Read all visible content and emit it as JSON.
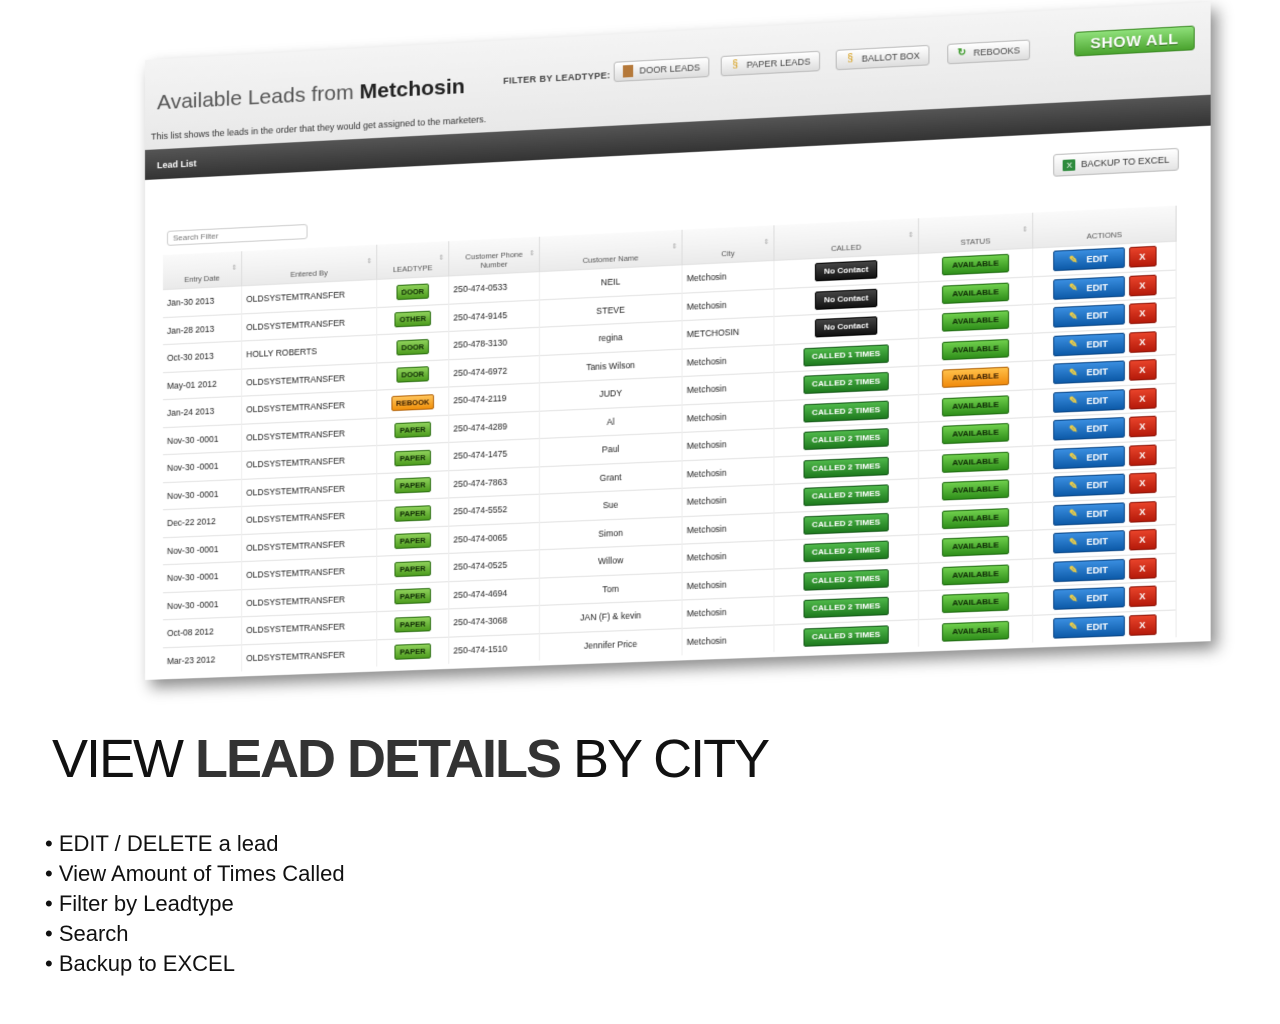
{
  "screen": {
    "title_prefix": "Available Leads from",
    "title_city": "Metchosin",
    "subtitle": "This list shows the leads in the order that they would get assigned to the marketers.",
    "filter_label": "FILTER BY LEADTYPE:",
    "filters": [
      {
        "label": "DOOR LEADS",
        "icon": "door-icon"
      },
      {
        "label": "PAPER LEADS",
        "icon": "paper-icon"
      },
      {
        "label": "BALLOT BOX",
        "icon": "ballot-icon"
      },
      {
        "label": "REBOOKS",
        "icon": "rebook-icon"
      }
    ],
    "show_all": "SHOW ALL",
    "section_title": "Lead List",
    "backup_label": "BACKUP TO EXCEL",
    "search_placeholder": "Search Filter",
    "columns": [
      "Entry Date",
      "Entered By",
      "LEADTYPE",
      "Customer Phone Number",
      "Customer Name",
      "City",
      "CALLED",
      "STATUS",
      "ACTIONS"
    ],
    "edit_label": "EDIT",
    "delete_label": "X",
    "rows": [
      {
        "date": "Jan-30 2013",
        "by": "OLDSYSTEMTRANSFER",
        "type": "DOOR",
        "phone": "250-474-0533",
        "name": "NEIL",
        "city": "Metchosin",
        "called": "No Contact",
        "status": "AVAILABLE"
      },
      {
        "date": "Jan-28 2013",
        "by": "OLDSYSTEMTRANSFER",
        "type": "OTHER",
        "phone": "250-474-9145",
        "name": "STEVE",
        "city": "Metchosin",
        "called": "No Contact",
        "status": "AVAILABLE"
      },
      {
        "date": "Oct-30 2013",
        "by": "HOLLY ROBERTS",
        "type": "DOOR",
        "phone": "250-478-3130",
        "name": "regina",
        "city": "METCHOSIN",
        "called": "No Contact",
        "status": "AVAILABLE"
      },
      {
        "date": "May-01 2012",
        "by": "OLDSYSTEMTRANSFER",
        "type": "DOOR",
        "phone": "250-474-6972",
        "name": "Tanis Wilson",
        "city": "Metchosin",
        "called": "CALLED 1 TIMES",
        "status": "AVAILABLE"
      },
      {
        "date": "Jan-24 2013",
        "by": "OLDSYSTEMTRANSFER",
        "type": "REBOOK",
        "phone": "250-474-2119",
        "name": "JUDY",
        "city": "Metchosin",
        "called": "CALLED 2 TIMES",
        "status": "AVAILABLE"
      },
      {
        "date": "Nov-30 -0001",
        "by": "OLDSYSTEMTRANSFER",
        "type": "PAPER",
        "phone": "250-474-4289",
        "name": "Al",
        "city": "Metchosin",
        "called": "CALLED 2 TIMES",
        "status": "AVAILABLE"
      },
      {
        "date": "Nov-30 -0001",
        "by": "OLDSYSTEMTRANSFER",
        "type": "PAPER",
        "phone": "250-474-1475",
        "name": "Paul",
        "city": "Metchosin",
        "called": "CALLED 2 TIMES",
        "status": "AVAILABLE"
      },
      {
        "date": "Nov-30 -0001",
        "by": "OLDSYSTEMTRANSFER",
        "type": "PAPER",
        "phone": "250-474-7863",
        "name": "Grant",
        "city": "Metchosin",
        "called": "CALLED 2 TIMES",
        "status": "AVAILABLE"
      },
      {
        "date": "Dec-22 2012",
        "by": "OLDSYSTEMTRANSFER",
        "type": "PAPER",
        "phone": "250-474-5552",
        "name": "Sue",
        "city": "Metchosin",
        "called": "CALLED 2 TIMES",
        "status": "AVAILABLE"
      },
      {
        "date": "Nov-30 -0001",
        "by": "OLDSYSTEMTRANSFER",
        "type": "PAPER",
        "phone": "250-474-0065",
        "name": "Simon",
        "city": "Metchosin",
        "called": "CALLED 2 TIMES",
        "status": "AVAILABLE"
      },
      {
        "date": "Nov-30 -0001",
        "by": "OLDSYSTEMTRANSFER",
        "type": "PAPER",
        "phone": "250-474-0525",
        "name": "Willow",
        "city": "Metchosin",
        "called": "CALLED 2 TIMES",
        "status": "AVAILABLE"
      },
      {
        "date": "Nov-30 -0001",
        "by": "OLDSYSTEMTRANSFER",
        "type": "PAPER",
        "phone": "250-474-4694",
        "name": "Tom",
        "city": "Metchosin",
        "called": "CALLED 2 TIMES",
        "status": "AVAILABLE"
      },
      {
        "date": "Oct-08 2012",
        "by": "OLDSYSTEMTRANSFER",
        "type": "PAPER",
        "phone": "250-474-3068",
        "name": "JAN (F) & kevin",
        "city": "Metchosin",
        "called": "CALLED 2 TIMES",
        "status": "AVAILABLE"
      },
      {
        "date": "Mar-23 2012",
        "by": "OLDSYSTEMTRANSFER",
        "type": "PAPER",
        "phone": "250-474-1510",
        "name": "Jennifer Price",
        "city": "Metchosin",
        "called": "CALLED 3 TIMES",
        "status": "AVAILABLE"
      }
    ]
  },
  "heading": {
    "part1": "VIEW ",
    "bold": "LEAD DETAILS",
    "part2": " BY CITY"
  },
  "bullets": [
    "EDIT / DELETE a lead",
    "View Amount of Times Called",
    "Filter by Leadtype",
    "Search",
    "Backup to EXCEL"
  ],
  "colors": {
    "green_button": "#4aa32e",
    "orange_button": "#f08a0c",
    "edit_blue": "#0d5aa8",
    "delete_red": "#b51a0a",
    "dark_bar": "#333333"
  }
}
